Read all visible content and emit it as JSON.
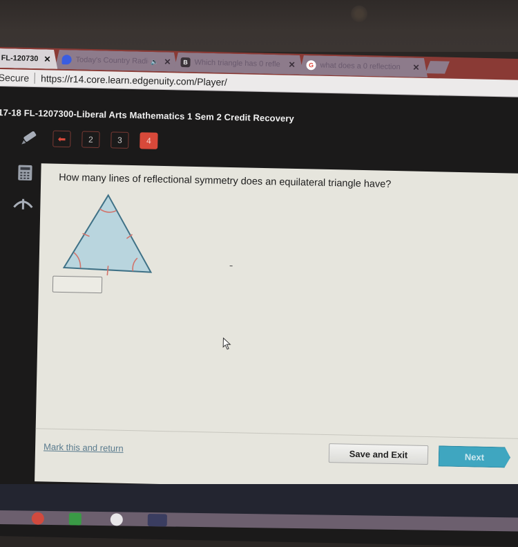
{
  "browser": {
    "tabs": [
      {
        "label": "FL-120730",
        "active": true,
        "icon": "edgenuity-icon"
      },
      {
        "label": "Today's Country Radic",
        "active": false,
        "icon": "pandora-icon",
        "audio": true
      },
      {
        "label": "Which triangle has 0 refle",
        "active": false,
        "icon": "brainly-icon",
        "icon_text": "B"
      },
      {
        "label": "what does a 0 reflection",
        "active": false,
        "icon": "google-icon",
        "icon_text": "G"
      }
    ],
    "close_glyph": "✕",
    "audio_glyph": "🔈",
    "security_label": "Secure",
    "url": "https://r14.core.learn.edgenuity.com/Player/"
  },
  "app": {
    "course_title": "17-18 FL-1207300-Liberal Arts Mathematics 1 Sem 2 Credit Recovery",
    "question_nav": [
      {
        "label": "2",
        "current": false
      },
      {
        "label": "3",
        "current": false
      },
      {
        "label": "4",
        "current": true
      }
    ],
    "back_glyph": "⬅",
    "tools": [
      "pencil-icon",
      "calculator-icon",
      "compass-icon"
    ]
  },
  "question": {
    "text": "How many lines of reflectional symmetry does an equilateral triangle have?",
    "figure": {
      "shape": "equilateral-triangle",
      "fill": "#b9d5de",
      "stroke": "#3f7186",
      "mark_color": "#d2736a"
    },
    "answer": {
      "value": "",
      "placeholder": ""
    }
  },
  "footer": {
    "mark_label": "Mark this and return",
    "save_label": "Save and Exit",
    "next_label": "Next"
  },
  "colors": {
    "accent_red": "#d8493a",
    "next_blue": "#3fa6c0",
    "panel_bg": "#e6e5dd"
  }
}
